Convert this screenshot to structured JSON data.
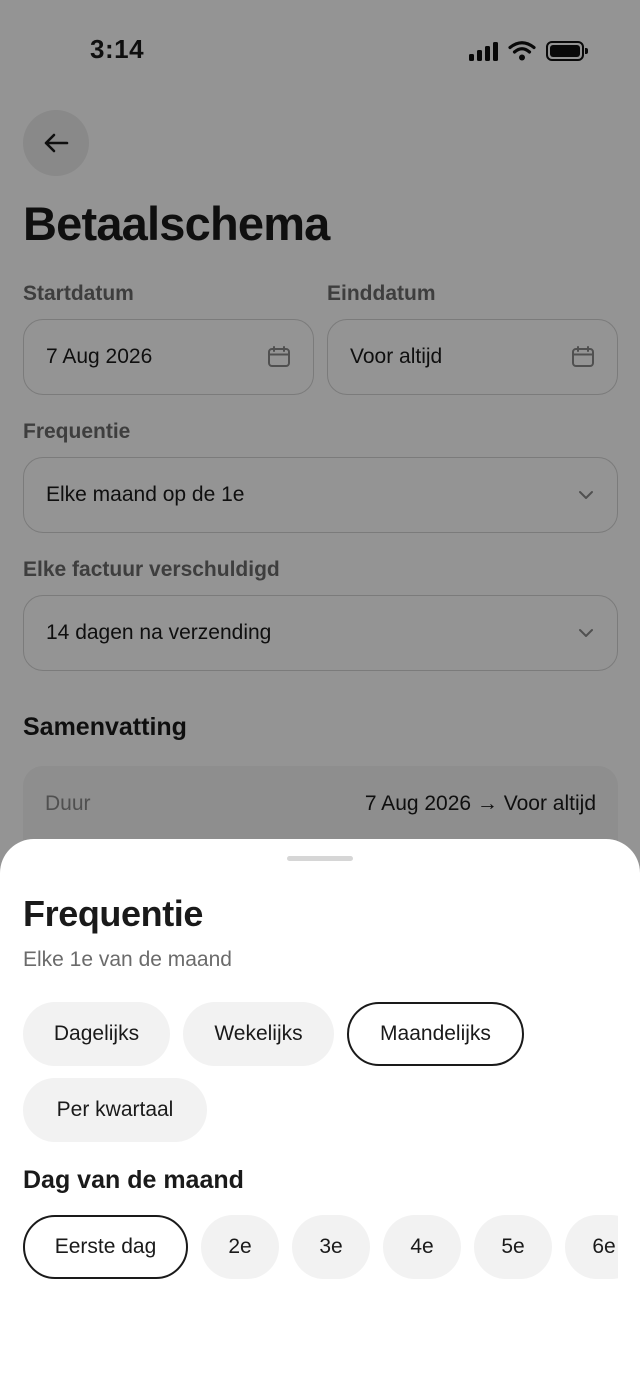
{
  "status_bar": {
    "time": "3:14"
  },
  "header": {
    "back_icon": "arrow-left-icon",
    "title": "Betaalschema"
  },
  "form": {
    "start": {
      "label": "Startdatum",
      "value": "7 Aug 2026",
      "icon": "calendar-icon"
    },
    "end": {
      "label": "Einddatum",
      "value": "Voor altijd",
      "icon": "calendar-icon"
    },
    "frequency": {
      "label": "Frequentie",
      "value": "Elke maand op de 1e",
      "icon": "chevron-down-icon"
    },
    "due": {
      "label": "Elke factuur verschuldigd",
      "value": "14 dagen na verzending",
      "icon": "chevron-down-icon"
    }
  },
  "summary": {
    "title": "Samenvatting",
    "rows": [
      {
        "label": "Duur",
        "value": "7 Aug 2026 → Voor altijd"
      }
    ]
  },
  "sheet": {
    "title": "Frequentie",
    "subtitle": "Elke 1e van de maand",
    "options": [
      {
        "label": "Dagelijks",
        "selected": false
      },
      {
        "label": "Wekelijks",
        "selected": false
      },
      {
        "label": "Maandelijks",
        "selected": true
      },
      {
        "label": "Per kwartaal",
        "selected": false
      }
    ],
    "day_section": "Dag van de maand",
    "days": [
      {
        "label": "Eerste dag",
        "selected": true
      },
      {
        "label": "2e",
        "selected": false
      },
      {
        "label": "3e",
        "selected": false
      },
      {
        "label": "4e",
        "selected": false
      },
      {
        "label": "5e",
        "selected": false
      },
      {
        "label": "6e",
        "selected": false
      }
    ]
  },
  "colors": {
    "text": "#1a1a1a",
    "muted": "#6b6b6b",
    "chip_bg": "#f2f2f2",
    "selected_border": "#1a1a1a",
    "scrim": "rgba(0,0,0,0.42)"
  }
}
